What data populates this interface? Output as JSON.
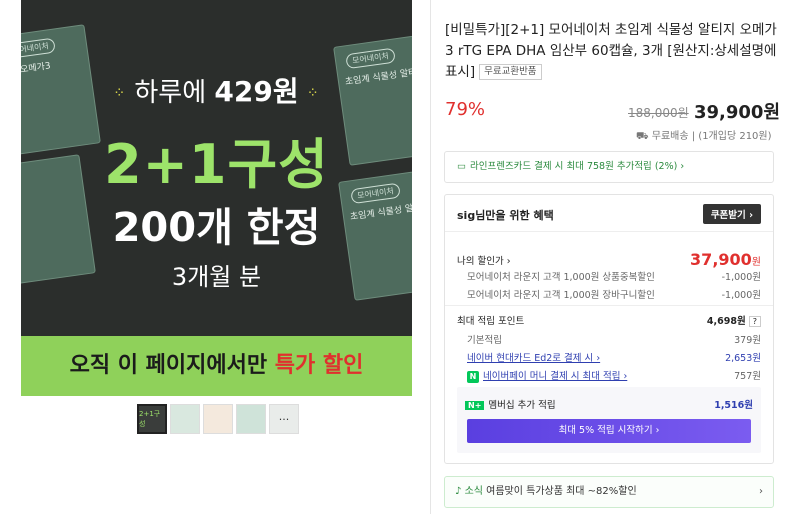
{
  "hero": {
    "box_labels": [
      "모어네이처",
      "모어네이처",
      "모어네이처",
      "모어네이처"
    ],
    "box_texts": [
      "초임계 식물성 알티지",
      "초임계 식물성 알티지",
      "TG 오메가3",
      "초임계 식물성 알티지"
    ],
    "line1_prefix": "하루에 ",
    "line1_value": "429원",
    "line2": "2+1구성",
    "line3": "200개 한정",
    "line4": "3개월 분",
    "banner_text": "오직 이 페이지에서만 ",
    "banner_highlight": "특가 할인",
    "thumb1": "2+1구성",
    "thumb5": "···"
  },
  "product": {
    "title": "[비밀특가][2+1] 모어네이처 초임계 식물성 알티지 오메가3 rTG EPA DHA 임산부 60캡슐, 3개 [원산지:상세설명에 표시]",
    "tag": "무료교환반품",
    "discount": "79%",
    "original_price": "188,000원",
    "price": "39,900원",
    "shipping": "무료배송 | (1개입당 210원)"
  },
  "card_banner": "라인프렌즈카드 결제 시 최대 758원 추가적립 (2%) ›",
  "benefit": {
    "header": "sig님만을 위한 혜택",
    "coupon_label": "쿠폰받기 ›",
    "my_discount_label": "나의 할인가 ›",
    "my_discount_value": "37,900",
    "my_discount_unit": "원",
    "sub1_label": "모어네이처 라운지 고객 1,000원 상품중복할인",
    "sub1_value": "-1,000원",
    "sub2_label": "모어네이처 라운지 고객 1,000원 장바구니할인",
    "sub2_value": "-1,000원",
    "points_label": "최대 적립 포인트",
    "points_value": "4,698원",
    "points_help": "?",
    "p1_label": "기본적립",
    "p1_value": "379원",
    "p2_label": "네이버 현대카드 Ed2로 결제 시 ›",
    "p2_value": "2,653원",
    "p3_icon": "N",
    "p3_label": "네이버페이 머니 결제 시 최대 적립 ›",
    "p3_value": "757원",
    "member_badge": "N+",
    "member_label": "멤버십 추가 적립",
    "member_value": "1,516원",
    "member_button": "최대 5% 적립 시작하기 ›"
  },
  "sale_banner": {
    "prefix": "소식",
    "text": " 여름맞이 특가상품 최대 ~82%할인",
    "arrow": "›"
  },
  "colors": {
    "accent_red": "#e0302e",
    "green": "#8fd15a",
    "purple": "#5a3fe0"
  }
}
